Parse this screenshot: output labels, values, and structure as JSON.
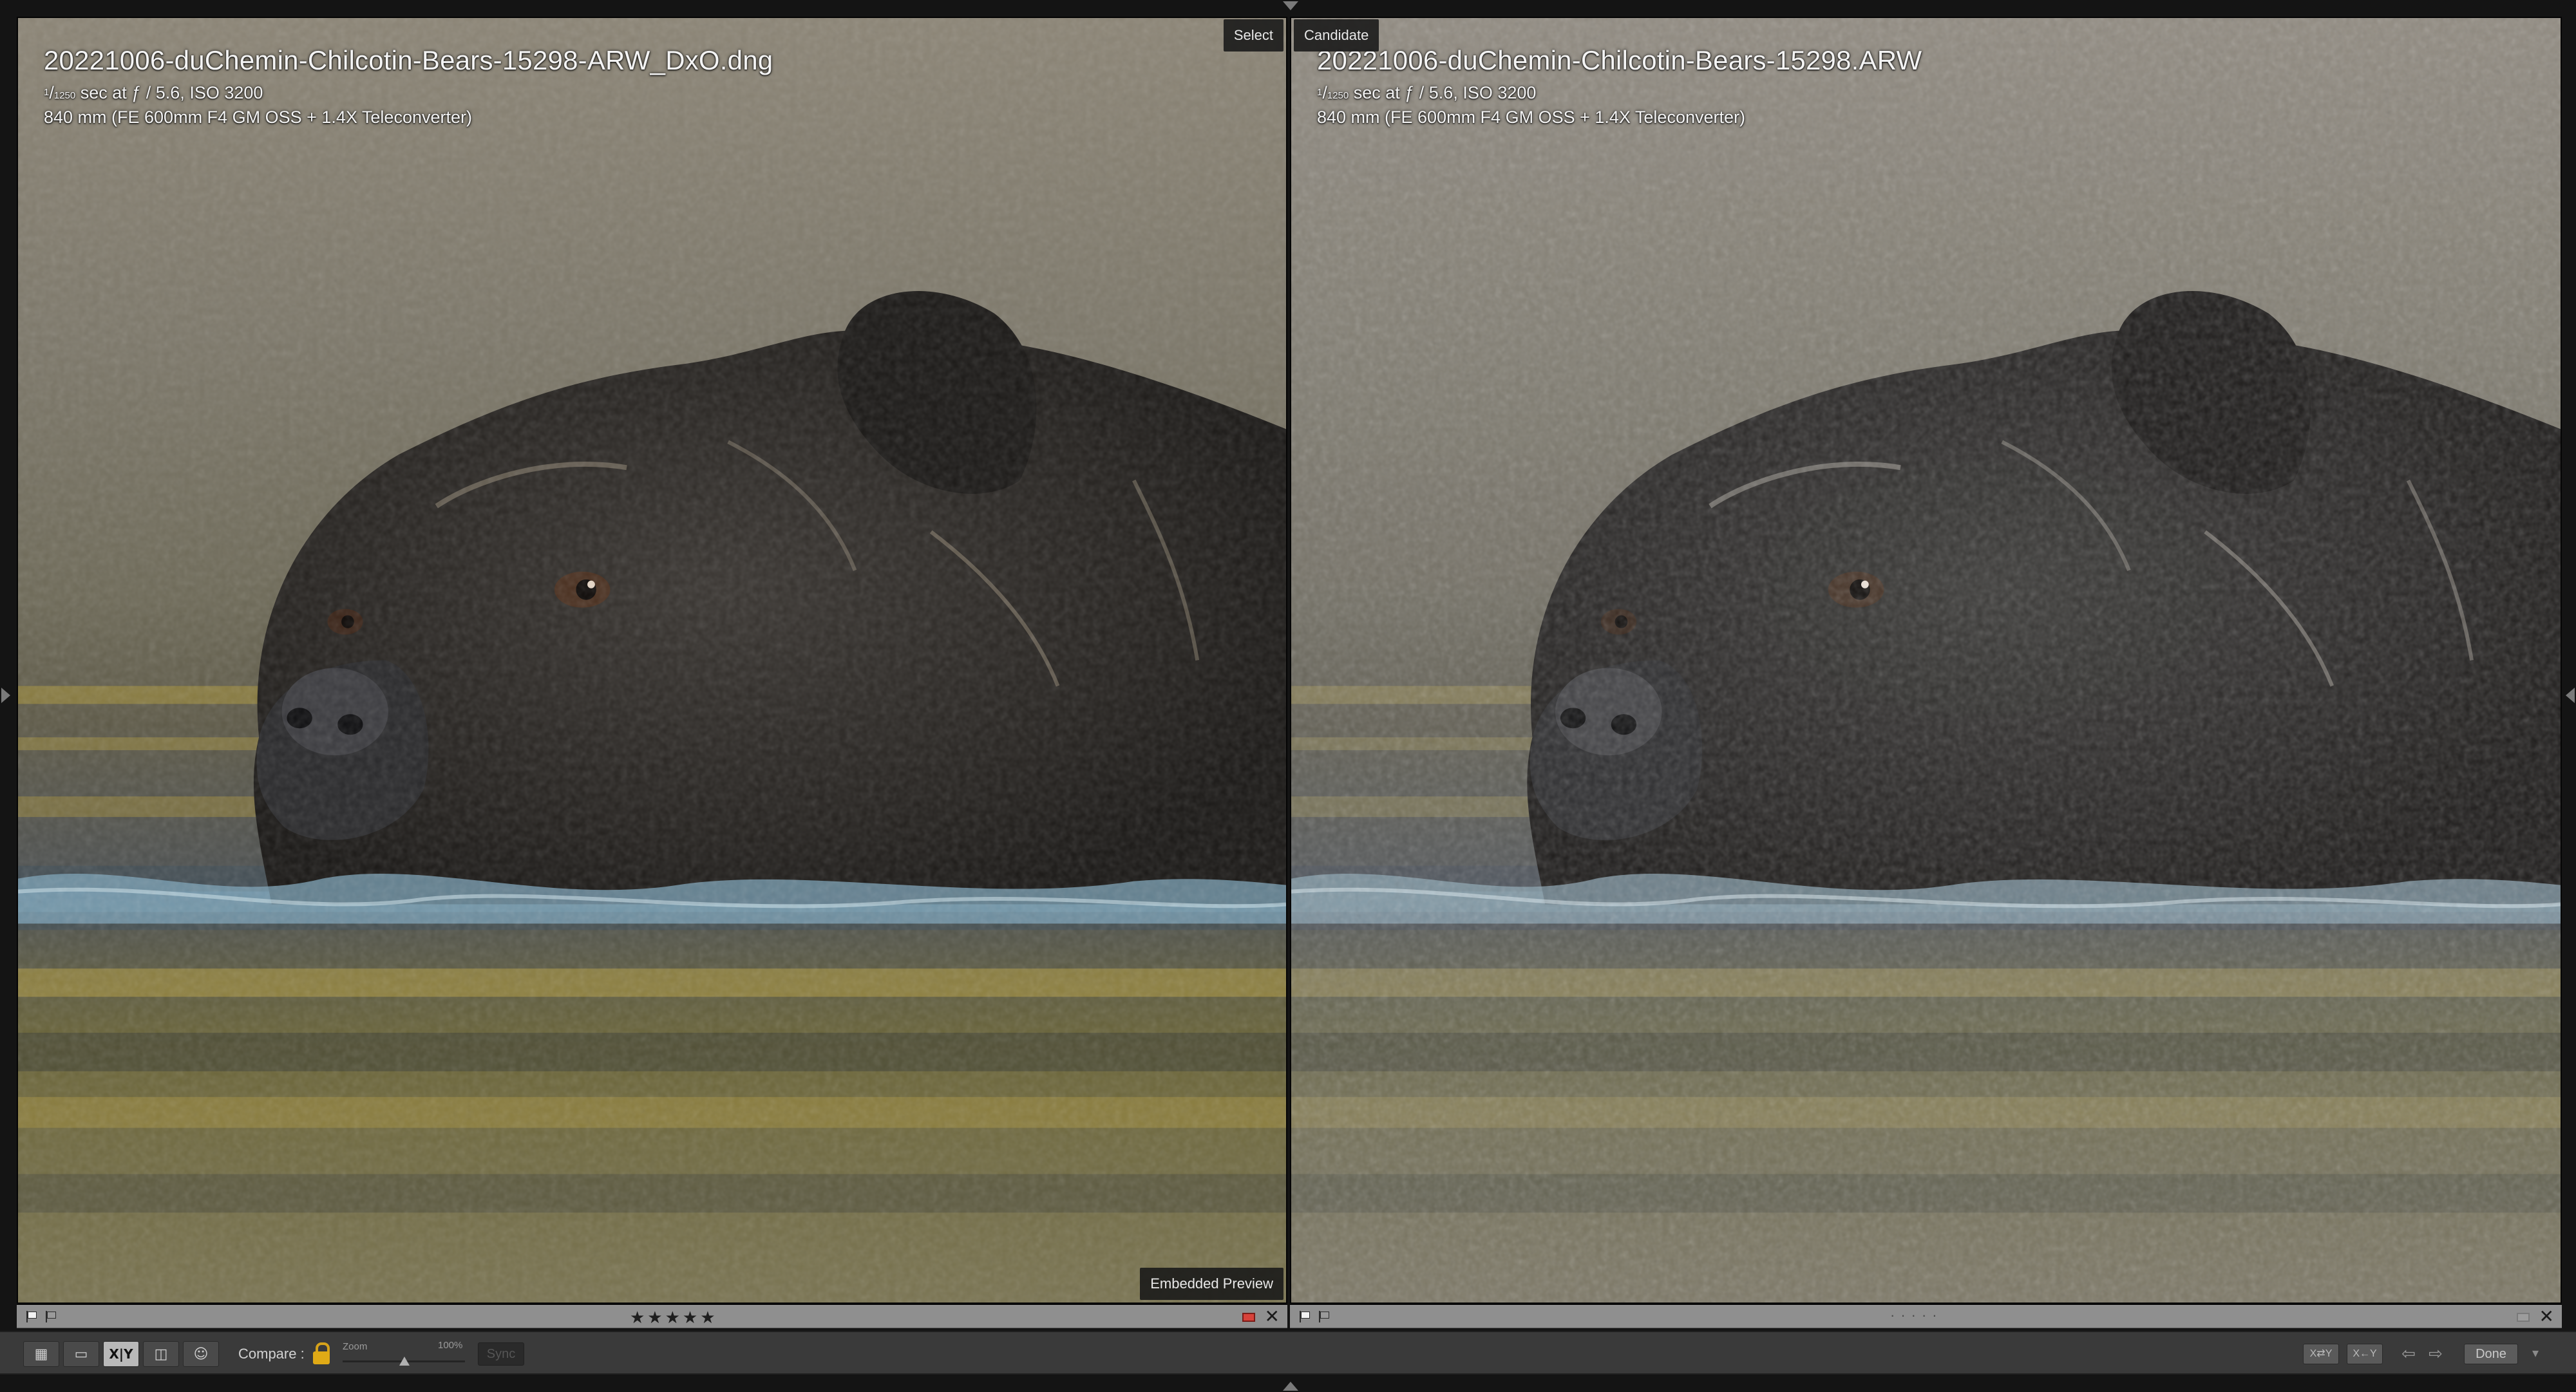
{
  "left_pane": {
    "tag": "Select",
    "filename": "20221006-duChemin-Chilcotin-Bears-15298-ARW_DxO.dng",
    "shutter_num": "1",
    "shutter_den": "1250",
    "exposure_rest": " sec at ƒ / 5.6, ISO 3200",
    "lens": "840 mm (FE 600mm F4 GM OSS + 1.4X Teleconverter)",
    "preview_label": "Embedded Preview",
    "stars": "★★★★★",
    "rating": 5,
    "color_label": "#d8423a",
    "close_glyph": "✕"
  },
  "right_pane": {
    "tag": "Candidate",
    "filename": "20221006-duChemin-Chilcotin-Bears-15298.ARW",
    "shutter_num": "1",
    "shutter_den": "1250",
    "exposure_rest": " sec at ƒ / 5.6, ISO 3200",
    "lens": "840 mm (FE 600mm F4 GM OSS + 1.4X Teleconverter)",
    "stars": "·····",
    "rating": 0,
    "close_glyph": "✕"
  },
  "toolbar": {
    "compare_label": "Compare :",
    "zoom_label": "Zoom",
    "zoom_value": "100%",
    "sync_label": "Sync",
    "done_label": "Done",
    "swap_label": "X⇄Y",
    "make_select_label": "X←Y",
    "prev_arrow": "⇦",
    "next_arrow": "⇨",
    "menu_glyph": "▾",
    "compare_icon_text": "X|Y",
    "lock_color": "#e0aa16"
  },
  "icons": [
    "grid-view-icon",
    "loupe-view-icon",
    "compare-view-icon",
    "survey-view-icon",
    "people-view-icon",
    "lock-icon",
    "flag-icon",
    "reject-flag-icon",
    "close-icon"
  ]
}
